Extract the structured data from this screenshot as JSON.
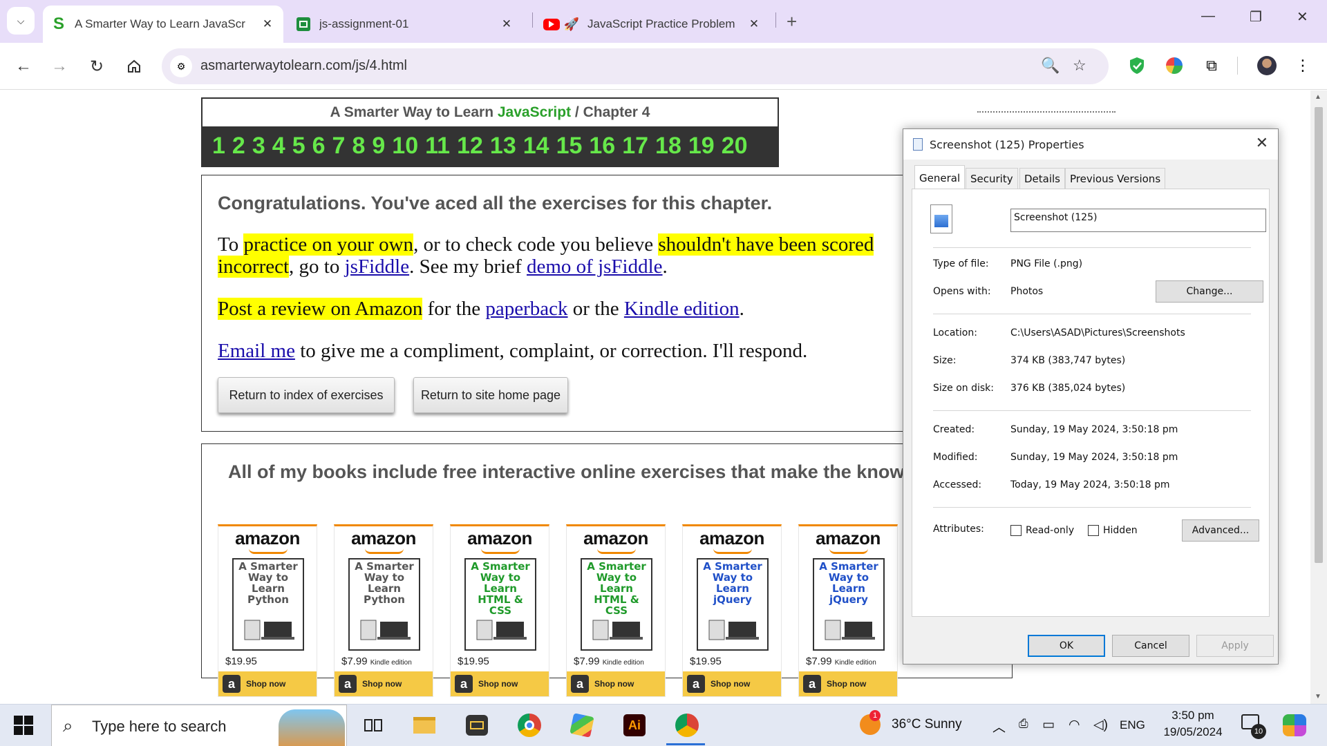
{
  "browser": {
    "tabs": [
      {
        "title": "A Smarter Way to Learn JavaScr",
        "favicon": "S",
        "active": true
      },
      {
        "title": "js-assignment-01",
        "favicon": "sheets-icon",
        "active": false
      },
      {
        "title": "JavaScript Practice Problem",
        "favicon": "youtube-rocket-icon",
        "active": false
      }
    ],
    "url": "asmarterwaytolearn.com/js/4.html"
  },
  "page": {
    "header": {
      "prefix": "A Smarter Way to Learn ",
      "js": "JavaScript",
      "suffix": " / Chapter 4",
      "chapters": [
        "1",
        "2",
        "3",
        "4",
        "5",
        "6",
        "7",
        "8",
        "9",
        "10",
        "11",
        "12",
        "13",
        "14",
        "15",
        "16",
        "17",
        "18",
        "19",
        "20"
      ]
    },
    "congrats": {
      "heading": "Congratulations. You've aced all the exercises for this chapter.",
      "p1_a": "To ",
      "p1_hl1": "practice on your own",
      "p1_b": ", or to check code you believe ",
      "p1_hl2": "shouldn't have been scored",
      "p2_hl": "incorrect",
      "p2_a": ", go to ",
      "p2_link1": "jsFiddle",
      "p2_b": ". See my brief ",
      "p2_link2": "demo of jsFiddle",
      "p2_c": ".",
      "p3_hl": "Post a review on Amazon",
      "p3_a": " for the ",
      "p3_link1": "paperback",
      "p3_b": " or the ",
      "p3_link2": "Kindle edition",
      "p3_c": ".",
      "p4_link": "Email me",
      "p4_a": " to give me a compliment, complaint, or correction. I'll respond.",
      "btn_index": "Return to index of exercises",
      "btn_home": "Return to site home page"
    },
    "books": {
      "heading": "All of my books include free interactive online exercises that make the knowledge stick.",
      "amazon": "amazon",
      "shop": "Shop now",
      "items": [
        {
          "title": "A Smarter Way to Learn Python",
          "price": "$19.95",
          "edition": "",
          "color": "#555555"
        },
        {
          "title": "A Smarter Way to Learn Python",
          "price": "$7.99",
          "edition": "Kindle edition",
          "color": "#555555"
        },
        {
          "title": "A Smarter Way to Learn HTML & CSS",
          "price": "$19.95",
          "edition": "",
          "color": "#1f9a2a"
        },
        {
          "title": "A Smarter Way to Learn HTML & CSS",
          "price": "$7.99",
          "edition": "Kindle edition",
          "color": "#1f9a2a"
        },
        {
          "title": "A Smarter Way to Learn jQuery",
          "price": "$19.95",
          "edition": "",
          "color": "#2050c8"
        },
        {
          "title": "A Smarter Way to Learn jQuery",
          "price": "$7.99",
          "edition": "Kindle edition",
          "color": "#2050c8"
        }
      ]
    }
  },
  "dialog": {
    "title": "Screenshot (125) Properties",
    "tabs": [
      "General",
      "Security",
      "Details",
      "Previous Versions"
    ],
    "filename": "Screenshot (125)",
    "rows": {
      "type_label": "Type of file:",
      "type_value": "PNG File (.png)",
      "opens_label": "Opens with:",
      "opens_value": "Photos",
      "change_btn": "Change...",
      "location_label": "Location:",
      "location_value": "C:\\Users\\ASAD\\Pictures\\Screenshots",
      "size_label": "Size:",
      "size_value": "374 KB (383,747 bytes)",
      "disk_label": "Size on disk:",
      "disk_value": "376 KB (385,024 bytes)",
      "created_label": "Created:",
      "created_value": "Sunday, 19 May 2024, 3:50:18 pm",
      "modified_label": "Modified:",
      "modified_value": "Sunday, 19 May 2024, 3:50:18 pm",
      "accessed_label": "Accessed:",
      "accessed_value": "Today, 19 May 2024, 3:50:18 pm",
      "attr_label": "Attributes:",
      "readonly": "Read-only",
      "hidden": "Hidden",
      "advanced_btn": "Advanced..."
    },
    "ok": "OK",
    "cancel": "Cancel",
    "apply": "Apply"
  },
  "taskbar": {
    "search_placeholder": "Type here to search",
    "weather": "36°C  Sunny",
    "weather_badge": "1",
    "lang": "ENG",
    "time": "3:50 pm",
    "date": "19/05/2024",
    "notif_count": "10"
  },
  "colors": {
    "accent": "#0078d7",
    "js_green": "#2aa02a",
    "chapter_green": "#66e84a",
    "highlight": "#ffff00"
  }
}
